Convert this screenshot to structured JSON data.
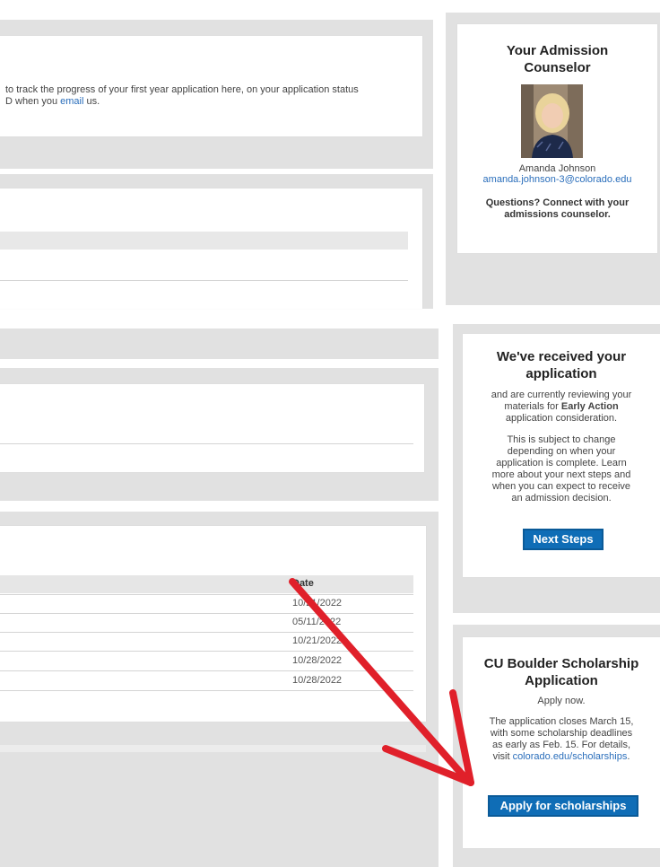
{
  "intro": {
    "line1": "to track the progress of your first year application here, on your application status",
    "line2_prefix": "D when you ",
    "line2_link": "email",
    "line2_suffix": " us."
  },
  "counselor": {
    "title_line1": "Your Admission",
    "title_line2": "Counselor",
    "name": "Amanda Johnson",
    "email": "amanda.johnson-3@colorado.edu",
    "cta_line1": "Questions? Connect with your",
    "cta_line2": "admissions counselor."
  },
  "received": {
    "title_line1": "We've received your",
    "title_line2": "application",
    "text1_line1": "and are currently reviewing your",
    "text1_line2_prefix": "materials for ",
    "text1_line2_bold": "Early Action",
    "text1_line3": "application consideration.",
    "text2_line1": "This is subject to change",
    "text2_line2": "depending on when your",
    "text2_line3": "application is complete. Learn",
    "text2_line4": "more about your next steps and",
    "text2_line5": "when you can expect to receive",
    "text2_line6": "an admission decision.",
    "button": "Next Steps"
  },
  "scholarship": {
    "title_line1": "CU Boulder Scholarship",
    "title_line2": "Application",
    "apply_now": "Apply now.",
    "text_line1": "The application closes March 15,",
    "text_line2": "with some scholarship deadlines",
    "text_line3": "as early as Feb. 15. For details,",
    "text_line4_prefix": "visit ",
    "text_line4_link": "colorado.edu/scholarships",
    "text_line4_suffix": ".",
    "button": "Apply for scholarships"
  },
  "table": {
    "header_date": "Date",
    "dates": [
      "10/21/2022",
      "05/11/2022",
      "10/21/2022",
      "10/28/2022",
      "10/28/2022"
    ]
  },
  "colors": {
    "accent": "#0f6db6",
    "link": "#2a6ebb",
    "arrow": "#e0202a",
    "panel_gray": "#e1e1e1"
  }
}
